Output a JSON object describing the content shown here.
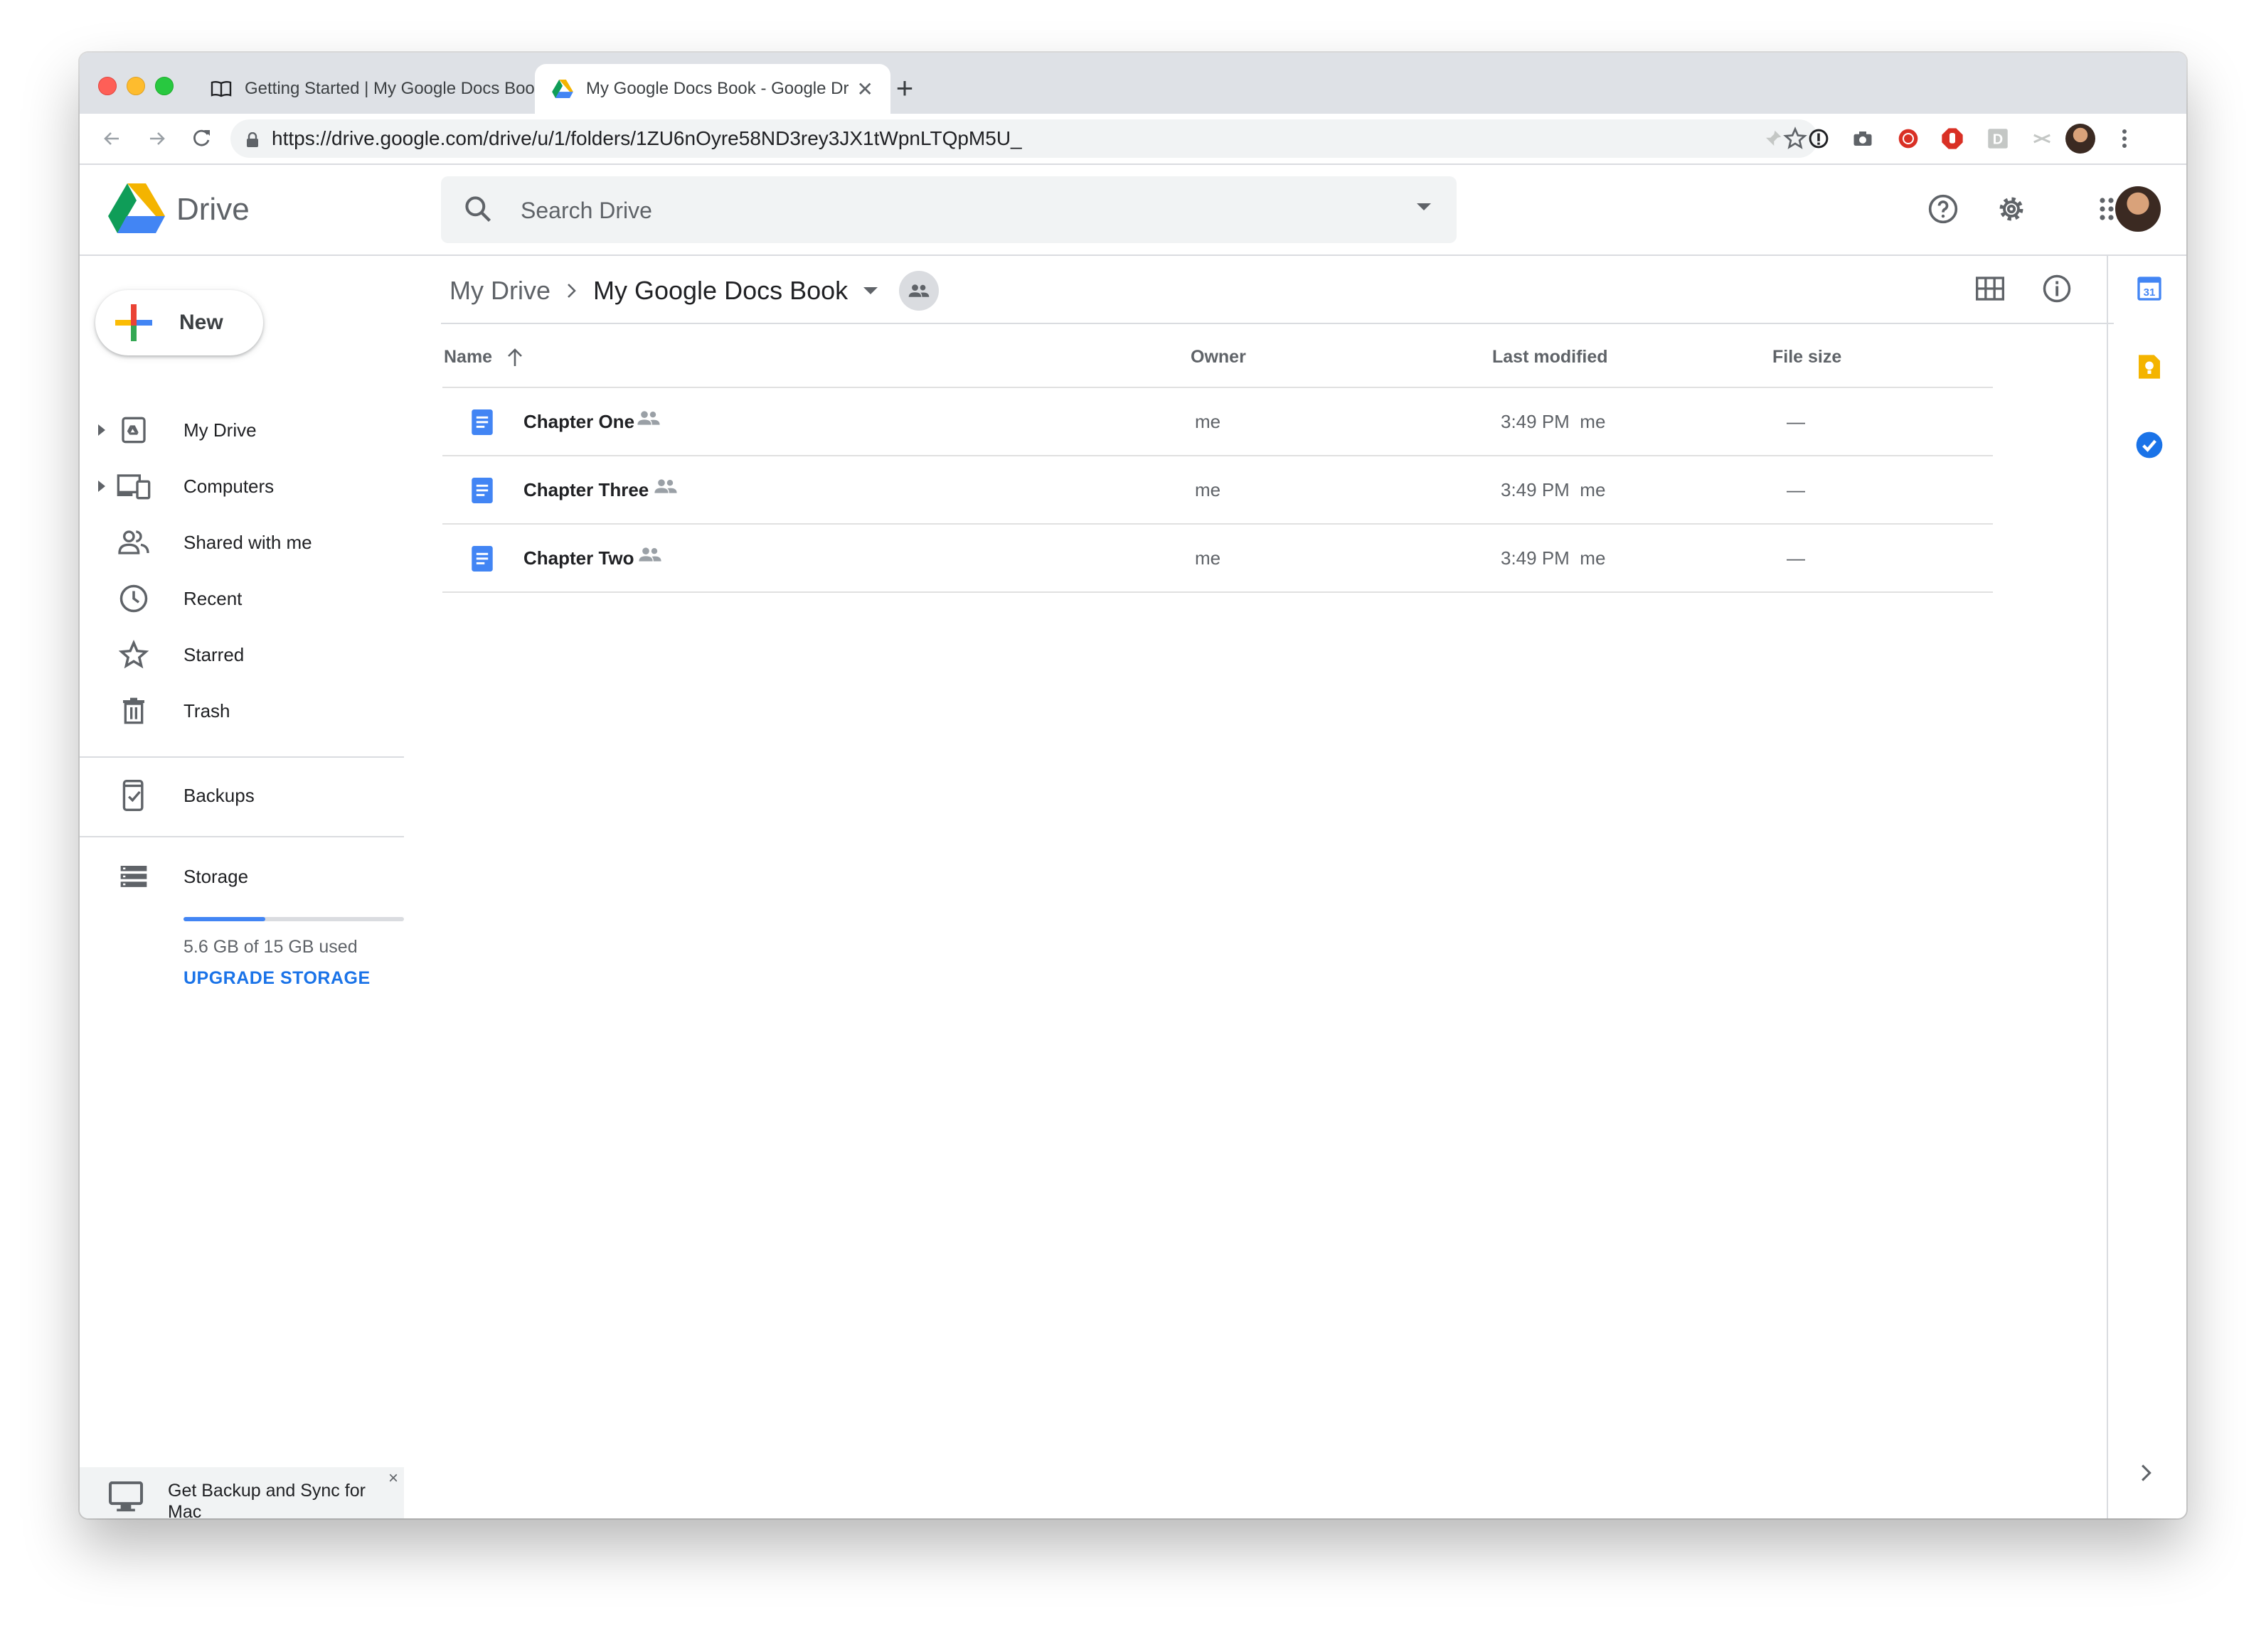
{
  "browser": {
    "tabs": [
      {
        "title": "Getting Started | My Google Docs Book",
        "favicon": "book-icon",
        "active": false
      },
      {
        "title": "My Google Docs Book - Google Drive",
        "favicon": "drive-logo-icon",
        "active": true
      }
    ],
    "url": "https://drive.google.com/drive/u/1/folders/1ZU6nOyre58ND3rey3JX1tWpnLTQpM5U_"
  },
  "app": {
    "name": "Drive",
    "search": {
      "placeholder": "Search Drive"
    }
  },
  "sidebar": {
    "new_label": "New",
    "items": [
      {
        "label": "My Drive",
        "icon": "my-drive-icon",
        "expandable": true
      },
      {
        "label": "Computers",
        "icon": "computers-icon",
        "expandable": true
      },
      {
        "label": "Shared with me",
        "icon": "shared-icon",
        "expandable": false
      },
      {
        "label": "Recent",
        "icon": "clock-icon",
        "expandable": false
      },
      {
        "label": "Starred",
        "icon": "star-icon",
        "expandable": false
      },
      {
        "label": "Trash",
        "icon": "trash-icon",
        "expandable": false
      }
    ],
    "backups_label": "Backups",
    "storage": {
      "label": "Storage",
      "used_text": "5.6 GB of 15 GB used",
      "used_fraction": 0.37,
      "upgrade_label": "UPGRADE STORAGE"
    },
    "promo": {
      "text": "Get Backup and Sync for Mac",
      "close": "×"
    }
  },
  "breadcrumb": {
    "root": "My Drive",
    "current": "My Google Docs Book"
  },
  "table": {
    "columns": {
      "name": "Name",
      "owner": "Owner",
      "modified": "Last modified",
      "size": "File size"
    },
    "rows": [
      {
        "name": "Chapter One",
        "owner": "me",
        "modified": "3:49 PM",
        "modified_by": "me",
        "size": "—"
      },
      {
        "name": "Chapter Three",
        "owner": "me",
        "modified": "3:49 PM",
        "modified_by": "me",
        "size": "—"
      },
      {
        "name": "Chapter Two",
        "owner": "me",
        "modified": "3:49 PM",
        "modified_by": "me",
        "size": "—"
      }
    ]
  },
  "colors": {
    "accent": "#1a73e8",
    "doc_blue": "#4285f4",
    "drive_green": "#0f9d58",
    "drive_yellow": "#f4b400",
    "drive_blue": "#4285f4"
  }
}
